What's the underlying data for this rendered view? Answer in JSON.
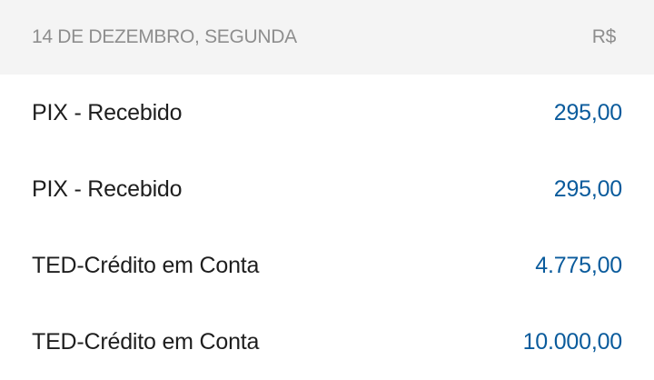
{
  "header": {
    "date": "14 DE DEZEMBRO, SEGUNDA",
    "currency": "R$"
  },
  "transactions": [
    {
      "description": "PIX - Recebido",
      "amount": "295,00"
    },
    {
      "description": "PIX - Recebido",
      "amount": "295,00"
    },
    {
      "description": "TED-Crédito em Conta",
      "amount": "4.775,00"
    },
    {
      "description": "TED-Crédito em Conta",
      "amount": "10.000,00"
    }
  ],
  "colors": {
    "amount": "#0a5b9c",
    "header_bg": "#f4f4f4",
    "header_text": "#8e8e8e"
  }
}
